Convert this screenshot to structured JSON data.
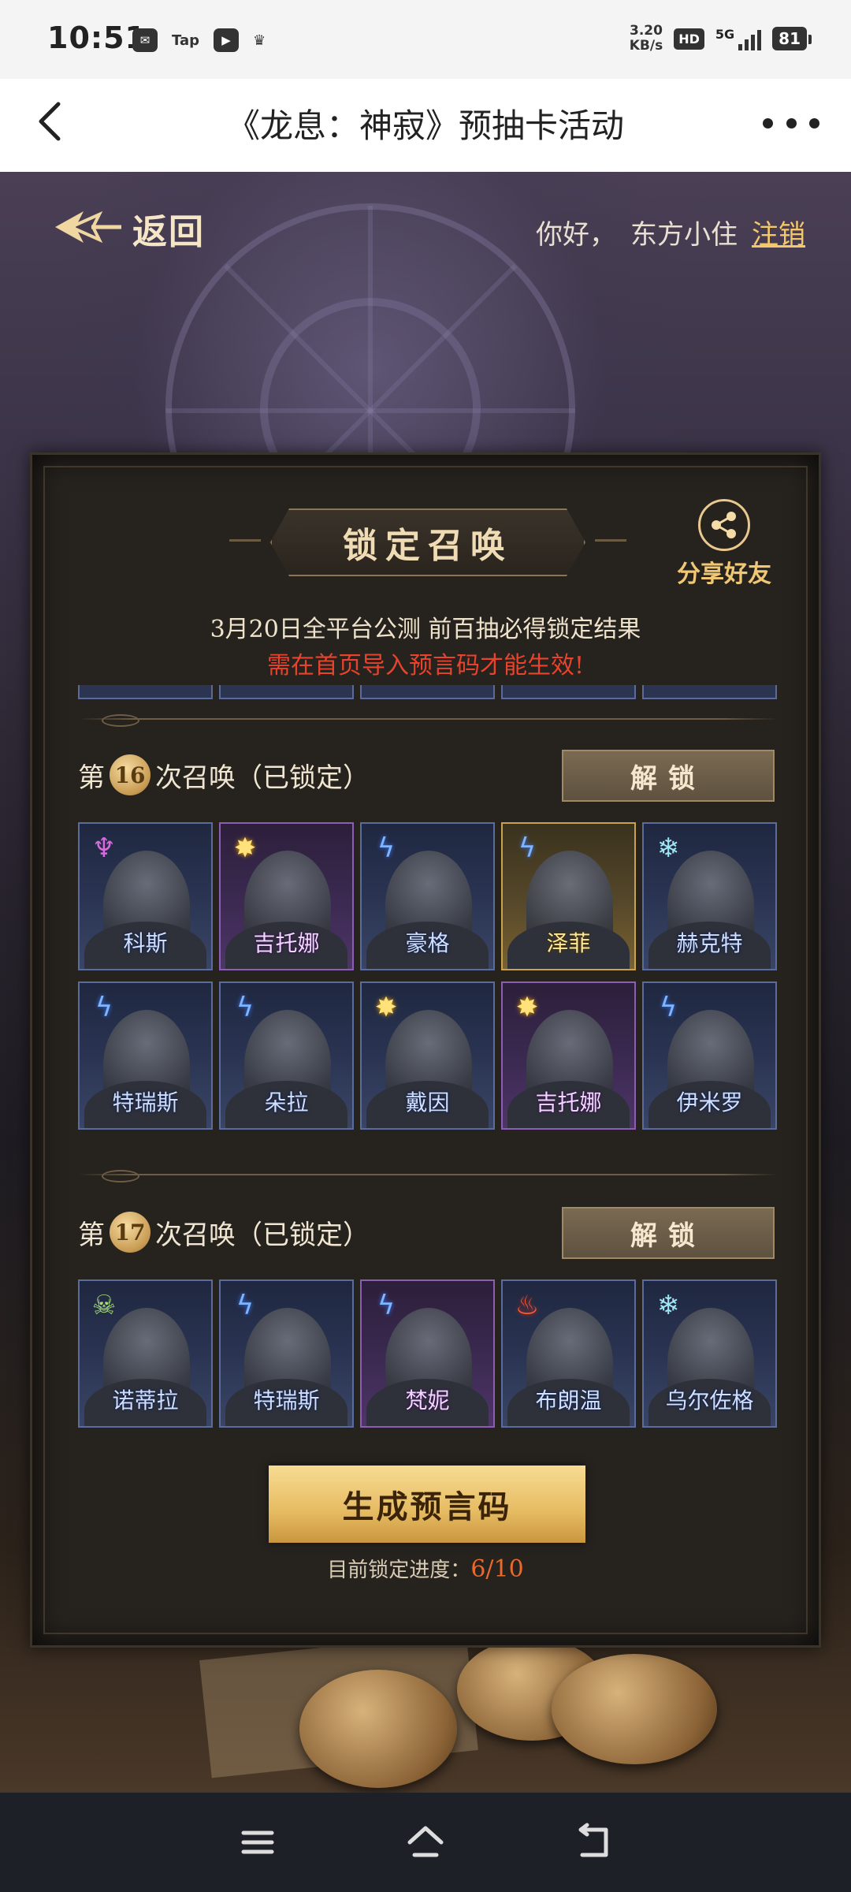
{
  "status_bar": {
    "time": "10:51",
    "left_icons": [
      "message-icon",
      "Tap",
      "media-icon",
      "crown-icon"
    ],
    "tap_label": "Tap",
    "net_speed_value": "3.20",
    "net_speed_unit": "KB/s",
    "hd": "HD",
    "network": "5G",
    "battery": "81"
  },
  "titlebar": {
    "title": "《龙息：神寂》预抽卡活动"
  },
  "header": {
    "back_label": "返回",
    "greeting": "你好，",
    "username": "东方小住",
    "logout": "注销"
  },
  "panel": {
    "title": "锁定召唤",
    "share_label": "分享好友",
    "notice_line1": "3月20日全平台公测 前百抽必得锁定结果",
    "notice_line2": "需在首页导入预言码才能生效!",
    "summons": [
      {
        "prefix": "第",
        "number": "16",
        "suffix": "次召唤（已锁定）",
        "unlock_label": "解锁",
        "characters": [
          {
            "name": "科斯",
            "element": "demon",
            "frame": "blue"
          },
          {
            "name": "吉托娜",
            "element": "light",
            "frame": "purple"
          },
          {
            "name": "豪格",
            "element": "thunder",
            "frame": "blue"
          },
          {
            "name": "泽菲",
            "element": "thunder",
            "frame": "gold"
          },
          {
            "name": "赫克特",
            "element": "frost",
            "frame": "blue"
          },
          {
            "name": "特瑞斯",
            "element": "thunder",
            "frame": "blue"
          },
          {
            "name": "朵拉",
            "element": "thunder",
            "frame": "blue"
          },
          {
            "name": "戴因",
            "element": "light",
            "frame": "blue"
          },
          {
            "name": "吉托娜",
            "element": "light",
            "frame": "purple"
          },
          {
            "name": "伊米罗",
            "element": "thunder",
            "frame": "blue"
          }
        ]
      },
      {
        "prefix": "第",
        "number": "17",
        "suffix": "次召唤（已锁定）",
        "unlock_label": "解锁",
        "characters": [
          {
            "name": "诺蒂拉",
            "element": "poison",
            "frame": "blue"
          },
          {
            "name": "特瑞斯",
            "element": "thunder",
            "frame": "blue"
          },
          {
            "name": "梵妮",
            "element": "thunder",
            "frame": "purple"
          },
          {
            "name": "布朗温",
            "element": "fire",
            "frame": "blue"
          },
          {
            "name": "乌尔佐格",
            "element": "frost",
            "frame": "blue"
          }
        ]
      }
    ],
    "generate_button": "生成预言码",
    "progress_label": "目前锁定进度：",
    "progress_value": "6/10"
  },
  "colors": {
    "accent_gold": "#f0c774",
    "notice_red": "#e8432c",
    "progress_orange": "#e86a2c",
    "frame_blue": "#5a6c9e",
    "frame_purple": "#8b5eb3",
    "frame_gold": "#c9a24c"
  },
  "navbar": {
    "items": [
      "menu-icon",
      "home-icon",
      "back-icon"
    ]
  }
}
